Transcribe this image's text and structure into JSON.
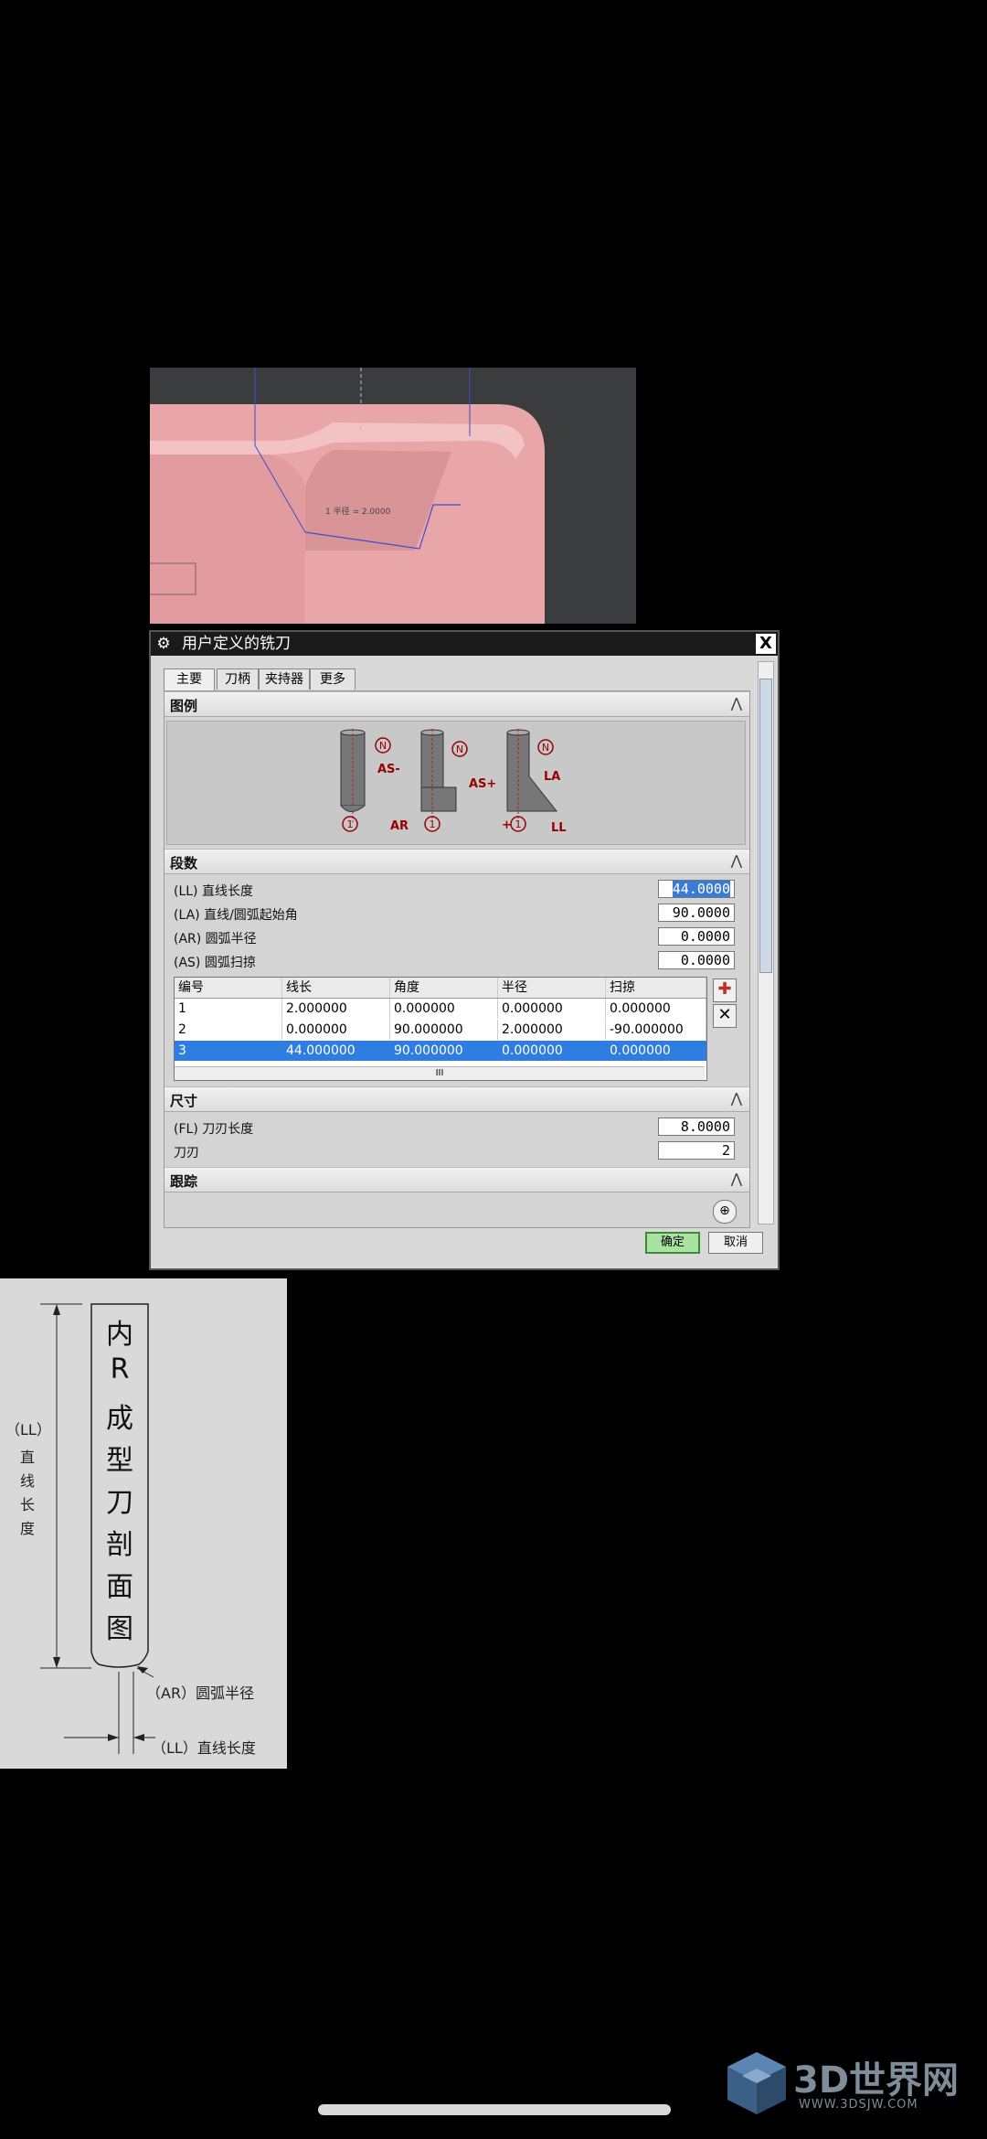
{
  "viewport": {
    "annotation": "1 半径 = 2.0000"
  },
  "dialog": {
    "title": "用户定义的铣刀",
    "close_label": "X",
    "tabs": [
      "主要",
      "刀柄",
      "夹持器",
      "更多"
    ],
    "sections": {
      "legend": "图例",
      "segments": "段数",
      "dimensions": "尺寸",
      "tracking": "跟踪"
    },
    "legend_labels": {
      "n": "N",
      "one": "1",
      "as_minus": "AS-",
      "as_plus": "AS+",
      "ar": "AR",
      "la": "LA",
      "ll": "LL",
      "plus": "+"
    },
    "params": [
      {
        "label": "(LL) 直线长度",
        "value": "44.0000"
      },
      {
        "label": "(LA) 直线/圆弧起始角",
        "value": "90.0000"
      },
      {
        "label": "(AR) 圆弧半径",
        "value": "0.0000"
      },
      {
        "label": "(AS) 圆弧扫掠",
        "value": "0.0000"
      }
    ],
    "table": {
      "headers": [
        "编号",
        "线长",
        "角度",
        "半径",
        "扫掠"
      ],
      "rows": [
        [
          "1",
          "2.000000",
          "0.000000",
          "0.000000",
          "0.000000"
        ],
        [
          "2",
          "0.000000",
          "90.000000",
          "2.000000",
          "-90.000000"
        ],
        [
          "3",
          "44.000000",
          "90.000000",
          "0.000000",
          "0.000000"
        ]
      ],
      "scroll_label": "III"
    },
    "dims": [
      {
        "label": "(FL) 刀刃长度",
        "value": "8.0000"
      },
      {
        "label": "刀刃",
        "value": "2"
      }
    ],
    "ok_label": "确定",
    "cancel_label": "取消"
  },
  "knife": {
    "title_chars": [
      "内",
      "R",
      "成",
      "型",
      "刀",
      "剖",
      "面",
      "图"
    ],
    "ll_vertical": [
      "（LL）",
      "直",
      "线",
      "长",
      "度"
    ],
    "ar_label": "（AR）圆弧半径",
    "ll_label": "（LL）直线长度"
  },
  "watermark": {
    "brand": "3D世界网",
    "url": "WWW.3DSJW.COM"
  }
}
